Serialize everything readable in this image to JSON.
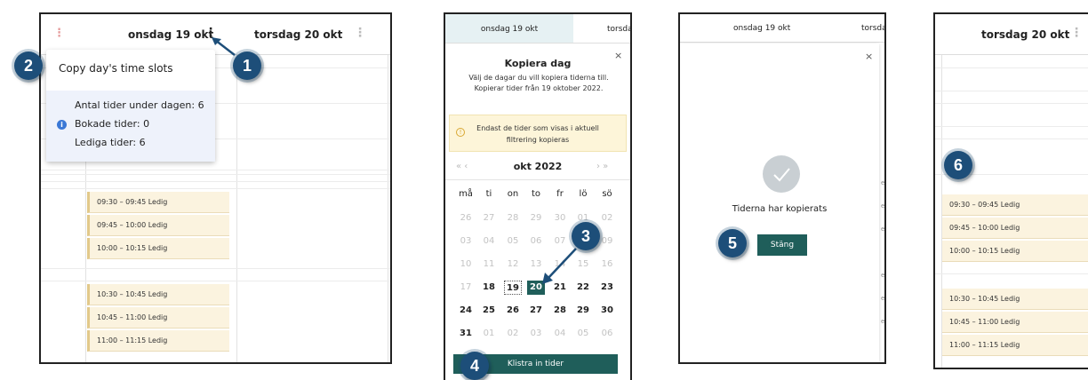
{
  "panel1": {
    "day_header": "onsdag 19 okt",
    "next_day_header": "torsdag 20 okt",
    "menu": {
      "item": "Copy day's time slots",
      "total_label": "Antal tider under dagen: 6",
      "booked_label": "Bokade tider: 0",
      "free_label": "Lediga tider: 6"
    },
    "slots": [
      "09:30 – 09:45  Ledig",
      "09:45 – 10:00  Ledig",
      "10:00 – 10:15  Ledig",
      "10:30 – 10:45  Ledig",
      "10:45 – 11:00  Ledig",
      "11:00 – 11:15  Ledig"
    ]
  },
  "panel2": {
    "tab_active": "onsdag 19 okt",
    "tab_next": "torsda",
    "dialog_title": "Kopiera dag",
    "description": "Välj de dagar du vill kopiera tiderna till. Kopierar tider från 19 oktober 2022.",
    "warning": "Endast de tider som visas i aktuell filtrering kopieras",
    "month_label": "okt  2022",
    "nav_prev": "« ‹",
    "nav_next": "› »",
    "weekdays": [
      "må",
      "ti",
      "on",
      "to",
      "fr",
      "lö",
      "sö"
    ],
    "weeks": [
      [
        "26",
        "27",
        "28",
        "29",
        "30",
        "01",
        "02"
      ],
      [
        "03",
        "04",
        "05",
        "06",
        "07",
        "08",
        "09"
      ],
      [
        "10",
        "11",
        "12",
        "13",
        "14",
        "15",
        "16"
      ],
      [
        "17",
        "18",
        "19",
        "20",
        "21",
        "22",
        "23"
      ],
      [
        "24",
        "25",
        "26",
        "27",
        "28",
        "29",
        "30"
      ],
      [
        "31",
        "01",
        "02",
        "03",
        "04",
        "05",
        "06"
      ]
    ],
    "paste_button": "Klistra in tider",
    "close": "×"
  },
  "panel3": {
    "day_header": "onsdag 19 okt",
    "next_header": "torsda",
    "success_text": "Tiderna har kopierats",
    "close_button": "Stäng",
    "close": "×"
  },
  "panel4": {
    "day_header": "torsdag 20 okt",
    "slots": [
      "09:30 – 09:45  Ledig",
      "09:45 – 10:00  Ledig",
      "10:00 – 10:15  Ledig",
      "10:30 – 10:45  Ledig",
      "10:45 – 11:00  Ledig",
      "11:00 – 11:15  Ledig"
    ]
  },
  "callouts": [
    "1",
    "2",
    "3",
    "4",
    "5",
    "6"
  ],
  "colors": {
    "callout": "#1d4e79",
    "primary_button": "#1f5e5a",
    "slot_bg": "#fbf3df",
    "info_bg": "#eef2fb",
    "warning_bg": "#fdf5d9"
  }
}
